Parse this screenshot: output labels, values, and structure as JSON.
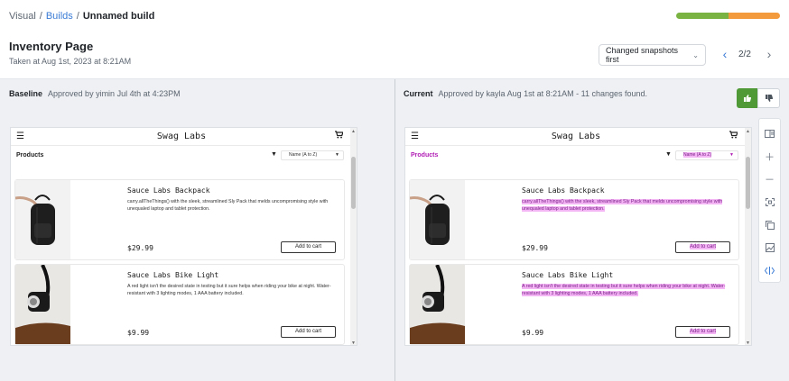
{
  "breadcrumb": {
    "root": "Visual",
    "sep1": "/",
    "mid": "Builds",
    "sep2": "/",
    "current": "Unnamed build"
  },
  "progress": {
    "green_fraction": 0.5,
    "orange_fraction": 0.5,
    "colors": {
      "green": "#7bb342",
      "orange": "#f39a3c"
    }
  },
  "page": {
    "title": "Inventory Page",
    "taken": "Taken at Aug 1st, 2023 at 8:21AM"
  },
  "sort_select": {
    "value": "Changed snapshots first"
  },
  "pager": {
    "text": "2/2"
  },
  "baseline": {
    "title": "Baseline",
    "meta": "Approved by yimin Jul 4th at 4:23PM"
  },
  "current": {
    "title": "Current",
    "meta": "Approved by kayla Aug 1st at 8:21AM - 11 changes found."
  },
  "accent": "#3a7bd5",
  "approve_color": "#4f9a37",
  "diff_highlight_color": "#e979e9",
  "icons": {
    "approve": "thumbs-up-icon",
    "reject": "thumbs-down-icon",
    "tools": [
      "split-view-icon",
      "zoom-in-icon",
      "zoom-out-icon",
      "fit-screen-icon",
      "copy-icon",
      "image-compare-icon",
      "diff-toggle-icon"
    ]
  },
  "snapshot": {
    "logo": "Swag Labs",
    "products_label": "Products",
    "sort_value": "Name (A to Z)",
    "items": [
      {
        "name": "Sauce Labs Backpack",
        "desc": "carry.allTheThings() with the sleek, streamlined Sly Pack that melds uncompromising style with unequaled laptop and tablet protection.",
        "price": "$29.99",
        "button": "Add to cart"
      },
      {
        "name": "Sauce Labs Bike Light",
        "desc": "A red light isn't the desired state in testing but it sure helps when riding your bike at night. Water-resistant with 3 lighting modes, 1 AAA battery included.",
        "price": "$9.99",
        "button": "Add to cart"
      }
    ]
  }
}
